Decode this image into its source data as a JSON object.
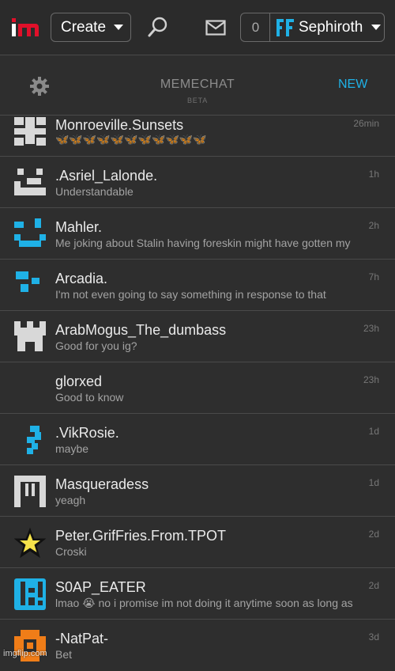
{
  "topbar": {
    "logo_name": "imgflip-logo",
    "create_label": "Create",
    "notification_count": "0",
    "username": "Sephiroth",
    "icons": [
      "search-icon",
      "mail-icon",
      "chevron-down-icon"
    ]
  },
  "header": {
    "title": "MEMECHAT",
    "subtitle": "BETA",
    "new_label": "NEW",
    "settings_icon": "gear-icon"
  },
  "colors": {
    "accent": "#1fb1e6",
    "avatar_gray": "#d8d8d8",
    "avatar_orange": "#f07d18"
  },
  "chats": [
    {
      "name": "Monroeville.Sunsets",
      "message": "🦋🦋🦋🦋🦋🦋🦋🦋🦋🦋🦋",
      "time": "26min"
    },
    {
      "name": ".Asriel_Lalonde.",
      "message": "Understandable",
      "time": "1h"
    },
    {
      "name": "Mahler.",
      "message": "Me joking about Stalin having foreskin might have gotten my",
      "time": "2h"
    },
    {
      "name": "Arcadia.",
      "message": "I'm not even going to say something in response to that",
      "time": "7h"
    },
    {
      "name": "ArabMogus_The_dumbass",
      "message": "Good for you ig?",
      "time": "23h"
    },
    {
      "name": "glorxed",
      "message": "Good to know",
      "time": "23h"
    },
    {
      "name": ".VikRosie.",
      "message": "maybe",
      "time": "1d"
    },
    {
      "name": "Masqueradess",
      "message": "yeagh",
      "time": "1d"
    },
    {
      "name": "Peter.GrifFries.From.TPOT",
      "message": "Croski",
      "time": "2d"
    },
    {
      "name": "S0AP_EATER",
      "message": "lmao 😭 no i promise im not doing it anytime soon as long as",
      "time": "2d"
    },
    {
      "name": "-NatPat-",
      "message": "Bet",
      "time": "3d"
    }
  ],
  "watermark": "imgflip.com"
}
